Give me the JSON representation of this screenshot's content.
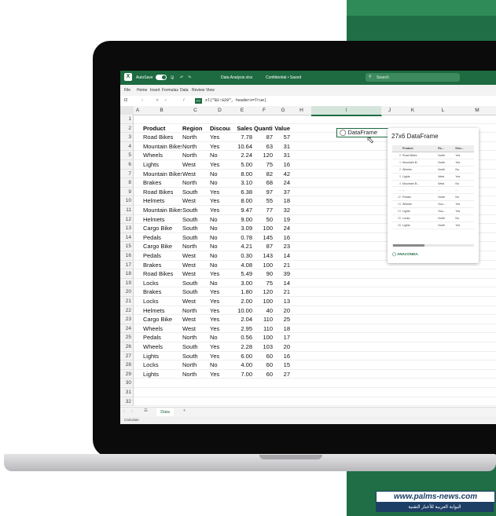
{
  "titlebar": {
    "autosave": "AutoSave",
    "doc_name": "Data Analysis.xlsx",
    "sensitivity": "Confidential • Saved",
    "search_placeholder": "Search"
  },
  "menu": [
    "File",
    "Home",
    "Insert",
    "Formulas",
    "Data",
    "Review",
    "View"
  ],
  "formula_bar": {
    "cell_ref": "I2",
    "badge": "PY",
    "formula": "xl(\"B2:G29\", headers=True)"
  },
  "columns": [
    "A",
    "B",
    "C",
    "D",
    "E",
    "F",
    "G",
    "H",
    "I",
    "J",
    "K",
    "L",
    "M"
  ],
  "headers": [
    "Product",
    "Region",
    "Discount",
    "Sales",
    "Quantity",
    "Value"
  ],
  "rows": [
    [
      "Road Bikes",
      "North",
      "Yes",
      "7.78",
      "87",
      "57"
    ],
    [
      "Mountain Bikes",
      "North",
      "Yes",
      "10.64",
      "63",
      "31"
    ],
    [
      "Wheels",
      "North",
      "No",
      "2.24",
      "120",
      "31"
    ],
    [
      "Lights",
      "West",
      "Yes",
      "5.00",
      "75",
      "16"
    ],
    [
      "Mountain Bikes",
      "West",
      "No",
      "8.00",
      "82",
      "42"
    ],
    [
      "Brakes",
      "North",
      "No",
      "3.10",
      "68",
      "24"
    ],
    [
      "Road Bikes",
      "South",
      "Yes",
      "6.38",
      "97",
      "37"
    ],
    [
      "Helmets",
      "West",
      "Yes",
      "8.00",
      "55",
      "18"
    ],
    [
      "Mountain Bikes",
      "South",
      "Yes",
      "9.47",
      "77",
      "32"
    ],
    [
      "Helmets",
      "South",
      "No",
      "9.00",
      "50",
      "19"
    ],
    [
      "Cargo Bike",
      "South",
      "No",
      "3.09",
      "100",
      "24"
    ],
    [
      "Pedals",
      "South",
      "No",
      "0.78",
      "145",
      "16"
    ],
    [
      "Cargo Bike",
      "North",
      "No",
      "4.21",
      "87",
      "23"
    ],
    [
      "Pedals",
      "West",
      "No",
      "0.30",
      "143",
      "14"
    ],
    [
      "Brakes",
      "West",
      "No",
      "4.08",
      "100",
      "21"
    ],
    [
      "Road Bikes",
      "West",
      "Yes",
      "5.49",
      "90",
      "39"
    ],
    [
      "Locks",
      "South",
      "No",
      "3.00",
      "75",
      "14"
    ],
    [
      "Brakes",
      "South",
      "Yes",
      "1.80",
      "120",
      "21"
    ],
    [
      "Locks",
      "West",
      "Yes",
      "2.00",
      "100",
      "13"
    ],
    [
      "Helmets",
      "North",
      "Yes",
      "10.00",
      "40",
      "20"
    ],
    [
      "Cargo Bike",
      "West",
      "Yes",
      "2.04",
      "110",
      "25"
    ],
    [
      "Wheels",
      "West",
      "Yes",
      "2.95",
      "110",
      "18"
    ],
    [
      "Pedals",
      "North",
      "No",
      "0.56",
      "100",
      "17"
    ],
    [
      "Wheels",
      "South",
      "Yes",
      "2.28",
      "103",
      "20"
    ],
    [
      "Lights",
      "South",
      "Yes",
      "6.00",
      "60",
      "16"
    ],
    [
      "Locks",
      "North",
      "No",
      "4.00",
      "60",
      "15"
    ],
    [
      "Lights",
      "North",
      "Yes",
      "7.00",
      "60",
      "27"
    ]
  ],
  "row_numbers": [
    "1",
    "2",
    "3",
    "4",
    "5",
    "6",
    "7",
    "8",
    "9",
    "10",
    "11",
    "12",
    "13",
    "14",
    "15",
    "16",
    "17",
    "18",
    "19",
    "20",
    "21",
    "22",
    "23",
    "24",
    "25",
    "26",
    "27",
    "28",
    "29",
    "30",
    "31",
    "32"
  ],
  "dataframe_cell": "DataFrame",
  "card": {
    "title": "27x6 DataFrame",
    "headers": [
      "Product",
      "Re...",
      "Disc..."
    ],
    "rows": [
      [
        "0",
        "Road Bikes",
        "North",
        "Yes"
      ],
      [
        "1",
        "Mountain B...",
        "North",
        "Yes"
      ],
      [
        "2",
        "Wheels",
        "North",
        "No"
      ],
      [
        "3",
        "Lights",
        "West",
        "Yes"
      ],
      [
        "4",
        "Mountain B...",
        "West",
        "No"
      ],
      [
        "...",
        "...",
        "...",
        "..."
      ],
      [
        "22",
        "Pedals",
        "North",
        "No"
      ],
      [
        "23",
        "Wheels",
        "Sou...",
        "Yes"
      ],
      [
        "24",
        "Lights",
        "Sou...",
        "Yes"
      ],
      [
        "25",
        "Locks",
        "North",
        "No"
      ],
      [
        "26",
        "Lights",
        "North",
        "Yes"
      ]
    ],
    "brand": "ANACONDA."
  },
  "sheet_tab": "Data",
  "status": "Calculate",
  "watermark": {
    "url": "www.palms-news.com",
    "arabic": "البوابة العربية للأخبار التقنية"
  },
  "colors": {
    "excel_green": "#1e6b41",
    "panel_green": "#1f6e45",
    "bezel": "#0b0b0b"
  }
}
